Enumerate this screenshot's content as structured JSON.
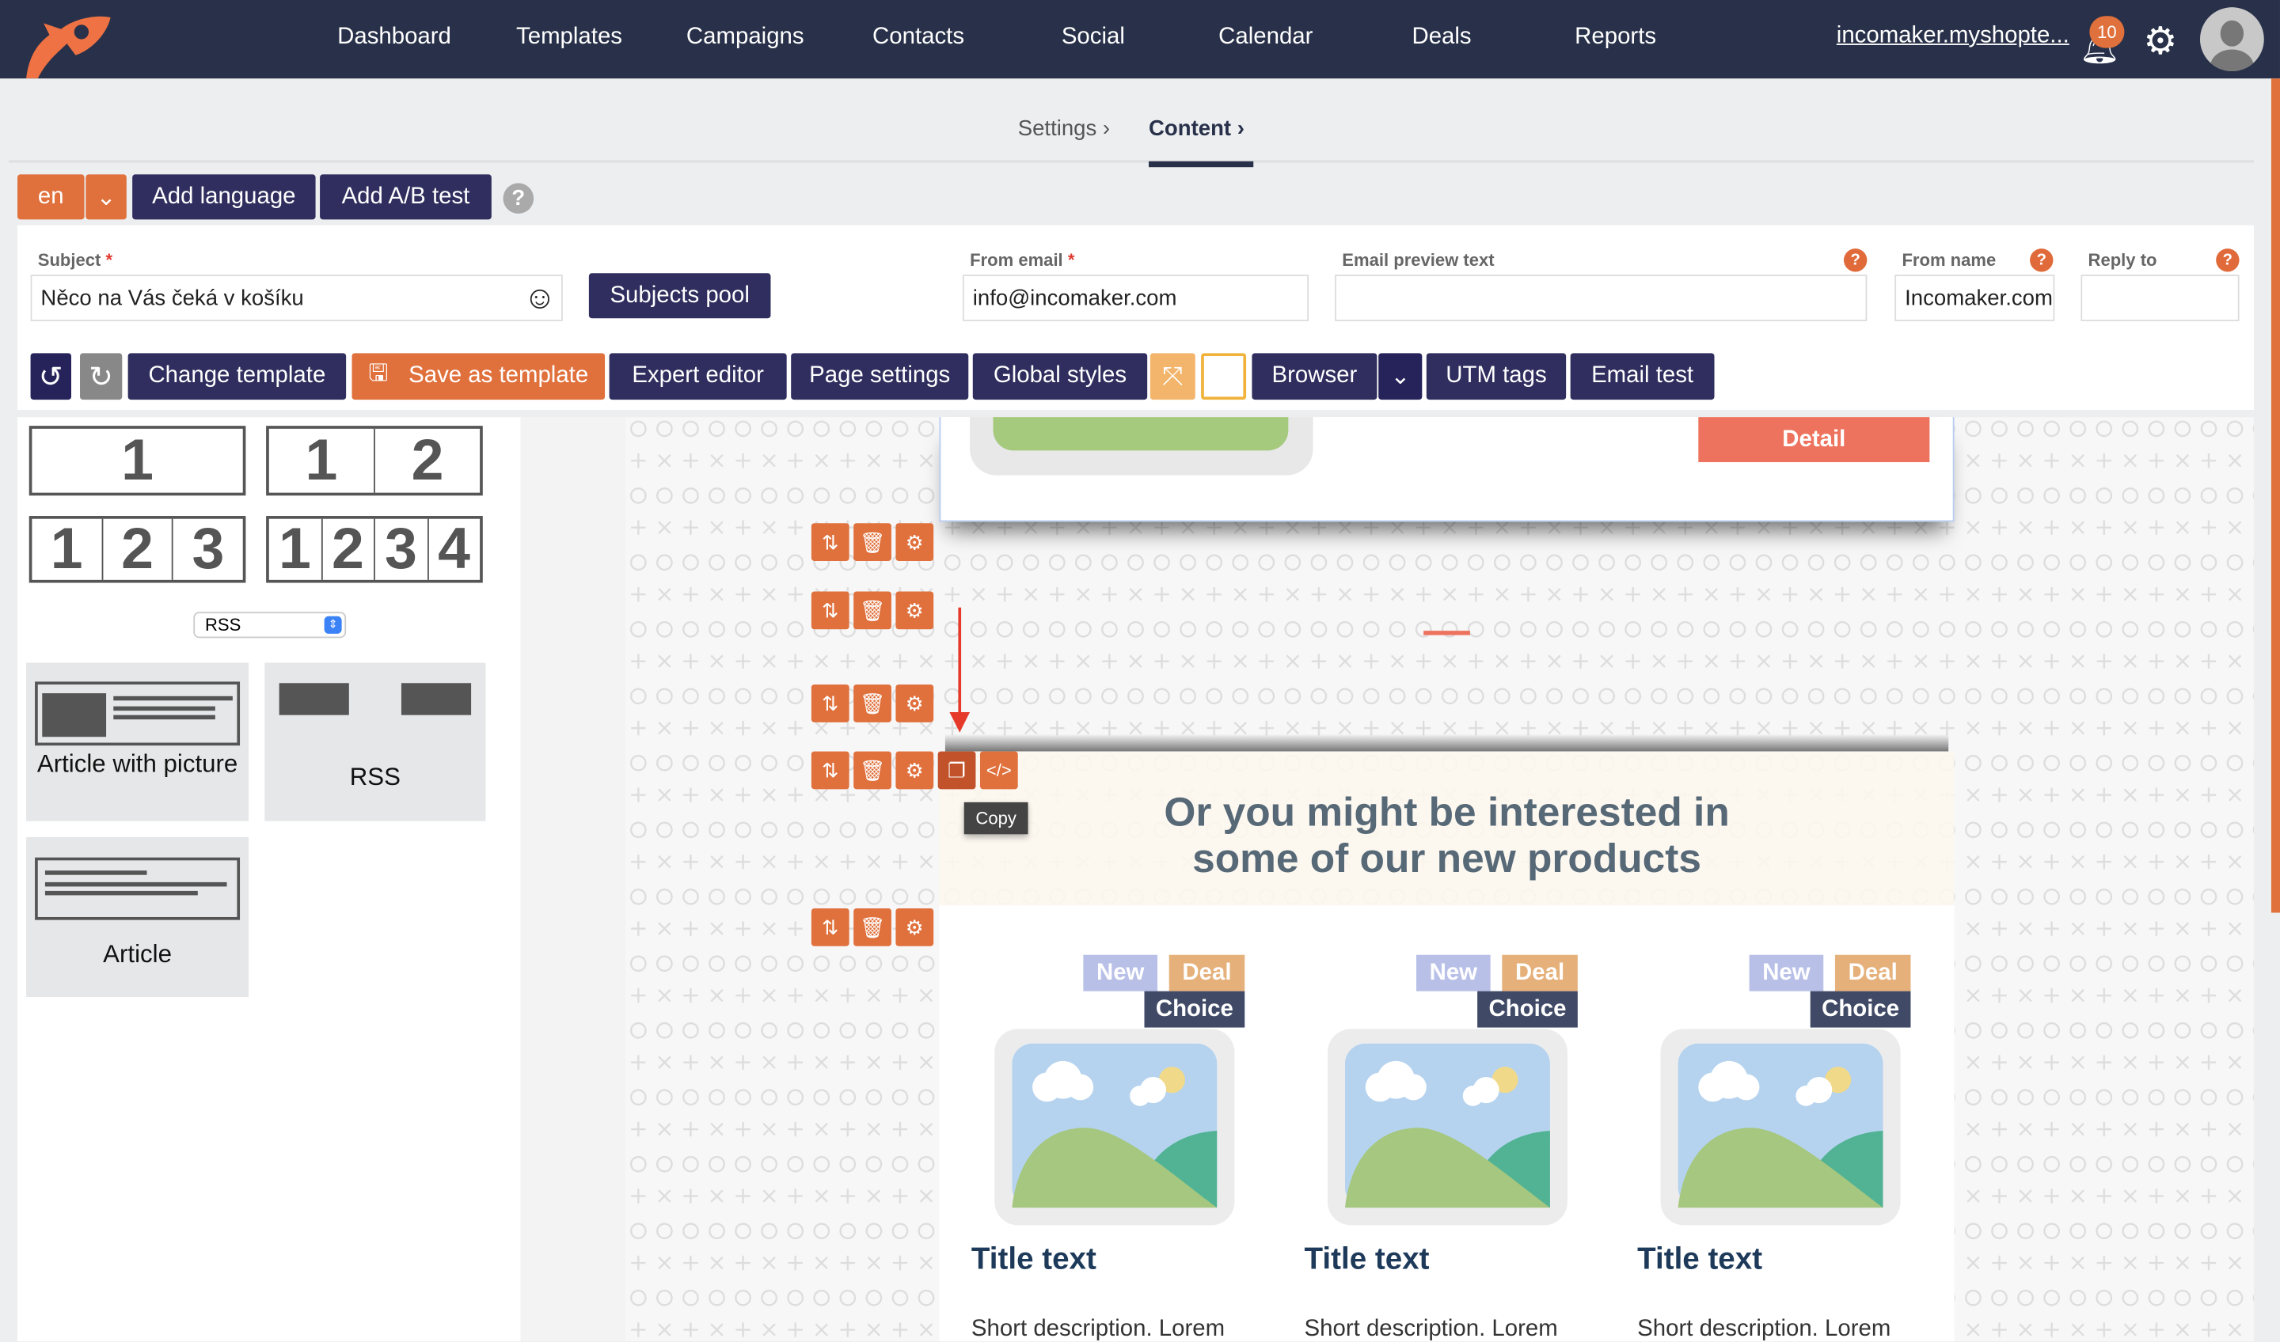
{
  "nav": {
    "items": [
      "Dashboard",
      "Templates",
      "Campaigns",
      "Contacts",
      "Social",
      "Calendar",
      "Deals",
      "Reports"
    ],
    "account": "incomaker.myshopte...",
    "notifications": "10"
  },
  "breadcrumb": {
    "settings": "Settings",
    "content": "Content"
  },
  "lang": {
    "current": "en",
    "add_language": "Add language",
    "add_ab": "Add A/B test",
    "help": "?"
  },
  "form": {
    "subject_label": "Subject",
    "subject_value": "Něco na Vás čeká v košíku",
    "subjects_pool": "Subjects pool",
    "from_email_label": "From email",
    "from_email_value": "info@incomaker.com",
    "preview_label": "Email preview text",
    "preview_value": "",
    "from_name_label": "From name",
    "from_name_value": "Incomaker.com",
    "reply_label": "Reply to",
    "reply_value": "",
    "required": "*",
    "help": "?"
  },
  "toolbar": {
    "change_template": "Change template",
    "save_as_template": "Save as template",
    "expert_editor": "Expert editor",
    "page_settings": "Page settings",
    "global_styles": "Global styles",
    "browser": "Browser",
    "utm": "UTM tags",
    "email_test": "Email test"
  },
  "blocks": {
    "one": [
      "1"
    ],
    "two": [
      "1",
      "2"
    ],
    "three": [
      "1",
      "2",
      "3"
    ],
    "four": [
      "1",
      "2",
      "3",
      "4"
    ],
    "select": "RSS",
    "cards": [
      "Article with picture",
      "RSS",
      "Article"
    ]
  },
  "canvas": {
    "detail": "Detail",
    "copy_tooltip": "Copy",
    "heading": "Or you might be interested in some of our new products",
    "products": [
      {
        "new": "New",
        "deal": "Deal",
        "choice": "Choice",
        "title": "Title text",
        "desc": "Short description. Lorem"
      },
      {
        "new": "New",
        "deal": "Deal",
        "choice": "Choice",
        "title": "Title text",
        "desc": "Short description. Lorem"
      },
      {
        "new": "New",
        "deal": "Deal",
        "choice": "Choice",
        "title": "Title text",
        "desc": "Short description. Lorem"
      }
    ]
  },
  "colors": {
    "nav": "#283149",
    "accent": "#e0703c",
    "button": "#2f2e5e",
    "detail": "#ee735e"
  }
}
